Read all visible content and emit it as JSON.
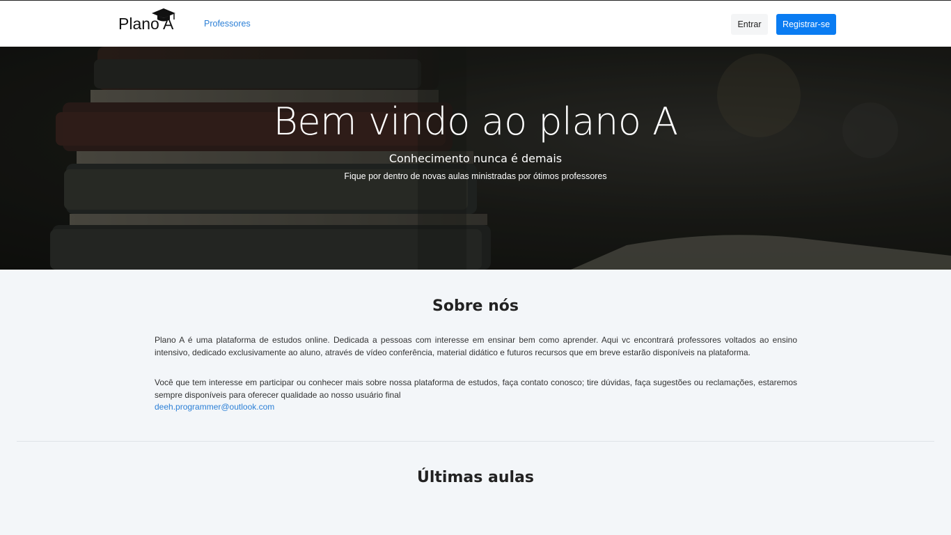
{
  "navbar": {
    "brand": "Plano A",
    "links": [
      {
        "label": "Professores"
      }
    ],
    "login_label": "Entrar",
    "register_label": "Registrar-se"
  },
  "hero": {
    "title": "Bem vindo ao plano A",
    "subtitle": "Conhecimento nunca é demais",
    "lead": "Fique por dentro de novas aulas ministradas por ótimos professores"
  },
  "about": {
    "title": "Sobre nós",
    "paragraph1": "Plano A é uma plataforma de estudos online. Dedicada a pessoas com interesse em ensinar bem como aprender. Aqui vc encontrará professores voltados ao ensino intensivo, dedicado exclusivamente ao aluno, através de vídeo conferência, material didático e futuros recursos que em breve estarão disponíveis na plataforma.",
    "paragraph2": "Você que tem interesse em participar ou conhecer mais sobre nossa plataforma de estudos, faça contato conosco; tire dúvidas, faça sugestões ou reclamações, estaremos sempre disponíveis para oferecer qualidade ao nosso usuário final",
    "email": "deeh.programmer@outlook.com"
  },
  "latest": {
    "title": "Últimas aulas"
  },
  "colors": {
    "accent": "#0a7cf2",
    "link": "#2b7fd6",
    "background": "#f3f6f9"
  },
  "icons": {
    "brand_icon": "graduation-cap-icon"
  }
}
